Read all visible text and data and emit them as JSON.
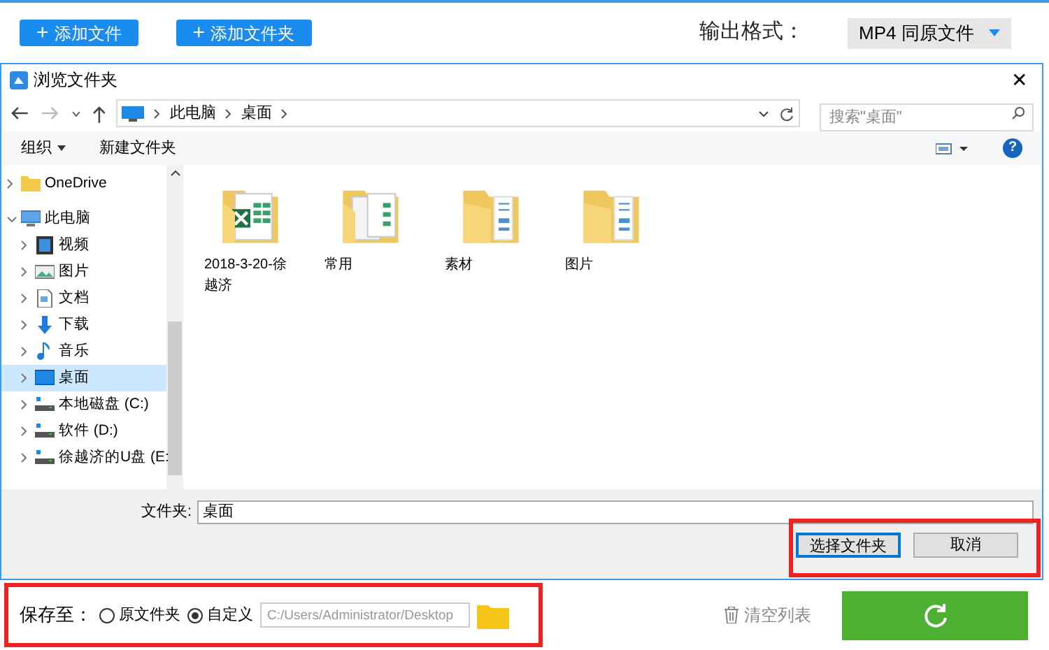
{
  "toolbar": {
    "buttons": [
      {
        "icon": "+",
        "label": "添加文件"
      },
      {
        "icon": "+",
        "label": "添加文件夹"
      }
    ],
    "format_label": "输出格式：",
    "format_value": "MP4  同原文件"
  },
  "dialog": {
    "title": "浏览文件夹",
    "close": "✕",
    "path": [
      "此电脑",
      "桌面"
    ],
    "search_placeholder": "搜索\"桌面\"",
    "help": "?",
    "commands": [
      {
        "label": "组织",
        "dropdown": true
      },
      {
        "label": "新建文件夹",
        "dropdown": false
      }
    ],
    "tree": [
      {
        "label": "OneDrive",
        "kind": "folder",
        "expanded": false,
        "selected": false
      },
      {
        "label": "此电脑",
        "kind": "pc",
        "expanded": true,
        "selected": false,
        "children": [
          {
            "label": "视频",
            "kind": "video",
            "expanded": false,
            "selected": false
          },
          {
            "label": "图片",
            "kind": "picture",
            "expanded": false,
            "selected": false
          },
          {
            "label": "文档",
            "kind": "doc",
            "expanded": false,
            "selected": false
          },
          {
            "label": "下载",
            "kind": "download",
            "expanded": false,
            "selected": false
          },
          {
            "label": "音乐",
            "kind": "music",
            "expanded": false,
            "selected": false
          },
          {
            "label": "桌面",
            "kind": "desktop",
            "expanded": false,
            "selected": true
          },
          {
            "label": "本地磁盘 (C:)",
            "kind": "drive",
            "expanded": false,
            "selected": false
          },
          {
            "label": "软件 (D:)",
            "kind": "drive",
            "expanded": false,
            "selected": false
          },
          {
            "label": "徐越济的U盘 (E:",
            "kind": "drive",
            "expanded": false,
            "selected": false
          }
        ]
      }
    ],
    "files": [
      {
        "name": "2018-3-20-徐越济",
        "kind": "excel"
      },
      {
        "name": "常用",
        "kind": "docs"
      },
      {
        "name": "素材",
        "kind": "images"
      },
      {
        "name": "图片",
        "kind": "images"
      }
    ],
    "folder_label": "文件夹:",
    "folder_value": "桌面",
    "ok": "选择文件夹",
    "cancel": "取消"
  },
  "footer": {
    "save_label": "保存至：",
    "options": [
      {
        "label": "原文件夹",
        "selected": false
      },
      {
        "label": "自定义",
        "selected": true
      }
    ],
    "path_placeholder": "C:/Users/Administrator/Desktop",
    "clear": "清空列表"
  }
}
